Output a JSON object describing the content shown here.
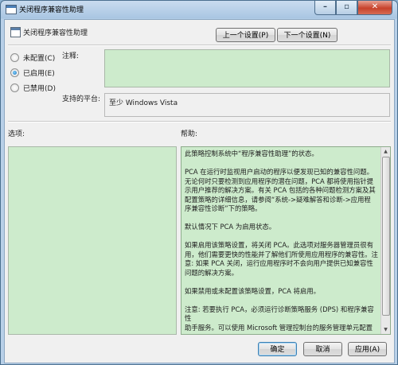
{
  "window": {
    "title": "关闭程序兼容性助理",
    "minimize": "–",
    "maximize": "▫",
    "close": "✕"
  },
  "header": {
    "policy_title": "关闭程序兼容性助理",
    "prev_button": "上一个设置(P)",
    "next_button": "下一个设置(N)"
  },
  "options": {
    "items": [
      {
        "label": "未配置(C)",
        "checked": false
      },
      {
        "label": "已启用(E)",
        "checked": true
      },
      {
        "label": "已禁用(D)",
        "checked": false
      }
    ]
  },
  "comment": {
    "label": "注释:",
    "value": ""
  },
  "platform": {
    "label": "支持的平台:",
    "value": "至少 Windows Vista"
  },
  "panels": {
    "options_label": "选项:",
    "help_label": "帮助:"
  },
  "help": {
    "paragraphs": [
      "此策略控制系统中“程序兼容性助理”的状态。",
      "PCA 在运行时监视用户启动的程序以便发现已知的兼容性问题。\n无论何时只要检测到应用程序的潜在问题，PCA 都将使用指针提\n示用户推荐的解决方案。有关 PCA 包括的各种问题检测方案及其\n配置策略的详细信息，请参阅“系统->疑难解答和诊断->应用程\n序兼容性诊断”下的策略。",
      "默认情况下 PCA 为启用状态。",
      "如果启用该策略设置，将关闭 PCA。此选项对服务器管理员很有\n用，他们需要更快的性能并了解他们所使用应用程序的兼容性。注\n意: 如果 PCA 关闭，运行应用程序时不会向用户提供已知兼容性\n问题的解决方案。",
      "如果禁用或未配置该策略设置，PCA 将启用。",
      "注意: 若要执行 PCA，必须运行诊断策略服务 (DPS) 和程序兼容性\n助手服务。可以使用 Microsoft 管理控制台的服务管理单元配置"
    ]
  },
  "footer": {
    "ok": "确定",
    "cancel": "取消",
    "apply": "应用(A)"
  }
}
